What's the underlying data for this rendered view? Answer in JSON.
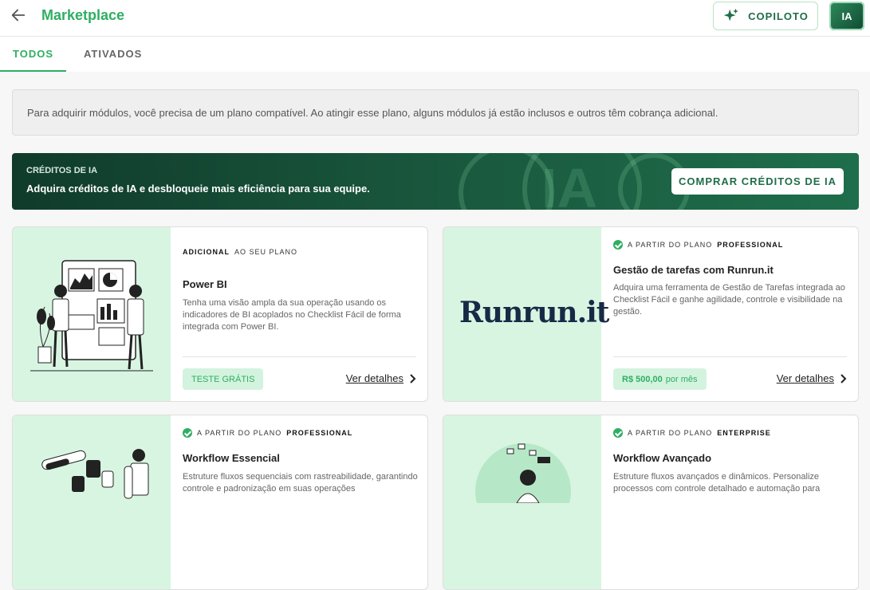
{
  "header": {
    "title": "Marketplace",
    "copilot_label": "COPILOTO",
    "avatar_initials": "IA"
  },
  "tabs": [
    {
      "label": "TODOS"
    },
    {
      "label": "ATIVADOS"
    }
  ],
  "notice": "Para adquirir módulos, você precisa de um plano compatível. Ao atingir esse plano, alguns módulos já estão inclusos e outros têm cobrança adicional.",
  "banner": {
    "kicker": "CRÉDITOS DE IA",
    "headline": "Adquira créditos de IA e desbloqueie mais eficiência para sua equipe.",
    "watermark": "IA",
    "button": "COMPRAR CRÉDITOS DE IA"
  },
  "cards": [
    {
      "badge_bold": "ADICIONAL",
      "badge_rest": "AO SEU PLANO",
      "title": "Power BI",
      "description": "Tenha uma visão ampla da sua operação usando os indicadores de BI acoplados no Checklist Fácil de forma integrada com Power BI.",
      "pill": "TESTE GRÁTIS",
      "details": "Ver detalhes"
    },
    {
      "badge_rest": "A PARTIR DO PLANO",
      "badge_bold": "PROFESSIONAL",
      "title": "Gestão de tarefas com Runrun.it",
      "description": "Adquira uma ferramenta de Gestão de Tarefas integrada ao Checklist Fácil e ganhe agilidade, controle e visibilidade na gestão.",
      "logo": "Runrun.it",
      "price": "R$ 500,00",
      "price_period": "por mês",
      "details": "Ver detalhes"
    },
    {
      "badge_rest": "A PARTIR DO PLANO",
      "badge_bold": "PROFESSIONAL",
      "title": "Workflow Essencial",
      "description": "Estruture fluxos sequenciais com rastreabilidade, garantindo controle e padronização em suas operações"
    },
    {
      "badge_rest": "A PARTIR DO PLANO",
      "badge_bold": "ENTERPRISE",
      "title": "Workflow Avançado",
      "description": "Estruture fluxos avançados e dinâmicos. Personalize processos com controle detalhado e automação para"
    }
  ],
  "colors": {
    "brand": "#2fae63",
    "dark": "#103b2b",
    "art_bg": "#d8f5e2"
  }
}
